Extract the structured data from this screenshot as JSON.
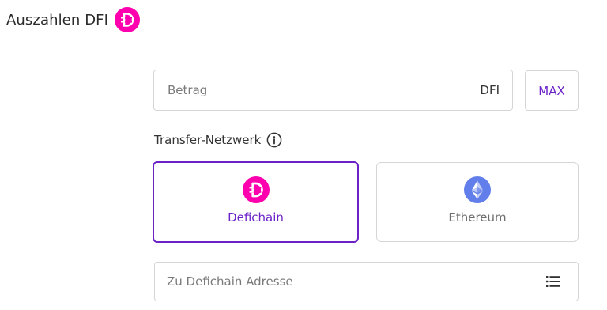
{
  "header": {
    "title": "Auszahlen DFI",
    "icon": "defichain-logo-icon"
  },
  "amount": {
    "placeholder": "Betrag",
    "value": "",
    "unit": "DFI",
    "max_label": "MAX"
  },
  "network": {
    "label": "Transfer-Netzwerk",
    "info_icon": "info-icon",
    "options": [
      {
        "label": "Defichain",
        "icon": "defichain-logo-icon",
        "selected": true
      },
      {
        "label": "Ethereum",
        "icon": "ethereum-logo-icon",
        "selected": false
      }
    ]
  },
  "address": {
    "placeholder": "Zu Defichain Adresse",
    "value": "",
    "icon": "address-book-list-icon"
  },
  "colors": {
    "accent": "#6b23c8",
    "defichain_brand": "#ff00af",
    "ethereum_brand": "#627eea",
    "border": "#d6d6d6"
  }
}
